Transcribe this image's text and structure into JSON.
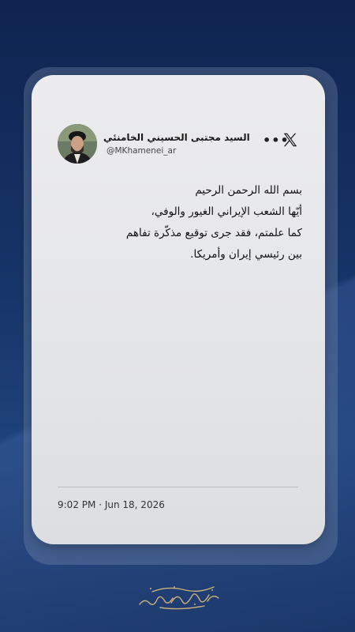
{
  "tweet": {
    "author_name": "السید مجتبی الحسیني الخامنئي",
    "handle": "@MKhamenei_ar",
    "lines": [
      "بسم الله الرحمن الرحيم",
      "أيّها الشعب الإيراني الغيور والوفي،",
      "كما علمتم، فقد جرى توقيع مذكّرة تفاهم",
      "بين رئيسي إيران وأمريكا."
    ],
    "time": "9:02 PM",
    "separator": "·",
    "date": "Jun 18, 2026"
  },
  "icons": {
    "more": "more-options-icon",
    "x_logo": "x-logo-icon",
    "signature": "calligraphy-signature"
  },
  "signature_text": "حضرت آیت الله سید مجتبی حسینی خامنه‌ای",
  "colors": {
    "background": "#173468",
    "card": "#e8e9eb",
    "text": "#111111"
  }
}
